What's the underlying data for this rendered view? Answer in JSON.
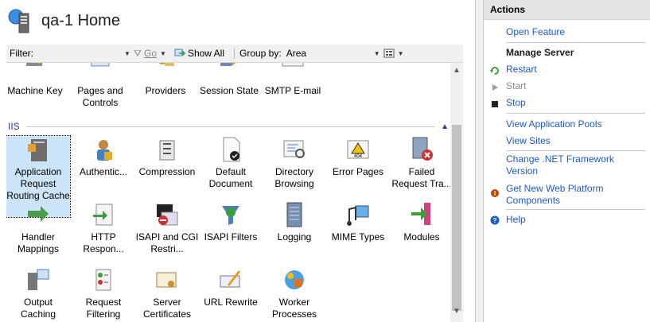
{
  "header": {
    "title": "qa-1 Home"
  },
  "filter_bar": {
    "filter_label": "Filter:",
    "filter_value": "",
    "go_label": "Go",
    "show_all_label": "Show All",
    "group_by_label": "Group by:",
    "group_by_value": "Area"
  },
  "row_top": [
    {
      "label": "Machine Key"
    },
    {
      "label": "Pages and Controls"
    },
    {
      "label": "Providers"
    },
    {
      "label": "Session State"
    },
    {
      "label": "SMTP E-mail"
    }
  ],
  "group": {
    "label": "IIS"
  },
  "iis_row1": [
    {
      "label": "Application Request Routing Cache"
    },
    {
      "label": "Authentic..."
    },
    {
      "label": "Compression"
    },
    {
      "label": "Default Document"
    },
    {
      "label": "Directory Browsing"
    },
    {
      "label": "Error Pages"
    },
    {
      "label": "Failed Request Tra..."
    }
  ],
  "iis_row2": [
    {
      "label": "Handler Mappings"
    },
    {
      "label": "HTTP Respon..."
    },
    {
      "label": "ISAPI and CGI Restri..."
    },
    {
      "label": "ISAPI Filters"
    },
    {
      "label": "Logging"
    },
    {
      "label": "MIME Types"
    },
    {
      "label": "Modules"
    }
  ],
  "iis_row3": [
    {
      "label": "Output Caching"
    },
    {
      "label": "Request Filtering"
    },
    {
      "label": "Server Certificates"
    },
    {
      "label": "URL Rewrite"
    },
    {
      "label": "Worker Processes"
    }
  ],
  "actions": {
    "title": "Actions",
    "open_feature": "Open Feature",
    "manage_server": "Manage Server",
    "restart": "Restart",
    "start": "Start",
    "stop": "Stop",
    "view_app_pools": "View Application Pools",
    "view_sites": "View Sites",
    "change_net": "Change .NET Framework Version",
    "get_components": "Get New Web Platform Components",
    "help": "Help"
  }
}
